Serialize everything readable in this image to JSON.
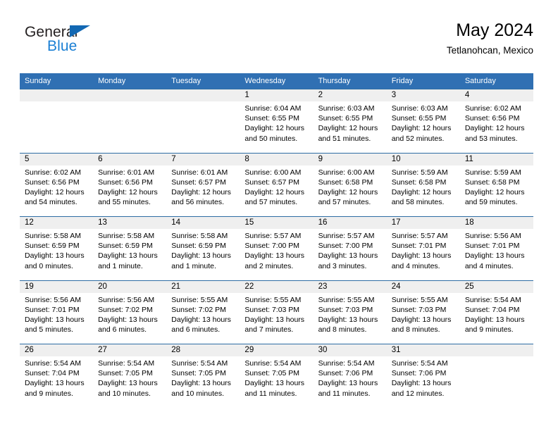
{
  "brand": {
    "name_top": "General",
    "name_bottom": "Blue",
    "accent_color": "#1268b3",
    "blue_text_color": "#1a7fd4"
  },
  "header": {
    "title": "May 2024",
    "subtitle": "Tetlanohcan, Mexico"
  },
  "theme": {
    "header_row_bg": "#3070b3",
    "cell_top_border": "#2e6da4",
    "daynum_bg": "#efefef"
  },
  "weekday_headers": [
    "Sunday",
    "Monday",
    "Tuesday",
    "Wednesday",
    "Thursday",
    "Friday",
    "Saturday"
  ],
  "weeks": [
    [
      {
        "day": "",
        "sunrise": "",
        "sunset": "",
        "daylight": "",
        "daylight2": ""
      },
      {
        "day": "",
        "sunrise": "",
        "sunset": "",
        "daylight": "",
        "daylight2": ""
      },
      {
        "day": "",
        "sunrise": "",
        "sunset": "",
        "daylight": "",
        "daylight2": ""
      },
      {
        "day": "1",
        "sunrise": "Sunrise: 6:04 AM",
        "sunset": "Sunset: 6:55 PM",
        "daylight": "Daylight: 12 hours",
        "daylight2": "and 50 minutes."
      },
      {
        "day": "2",
        "sunrise": "Sunrise: 6:03 AM",
        "sunset": "Sunset: 6:55 PM",
        "daylight": "Daylight: 12 hours",
        "daylight2": "and 51 minutes."
      },
      {
        "day": "3",
        "sunrise": "Sunrise: 6:03 AM",
        "sunset": "Sunset: 6:55 PM",
        "daylight": "Daylight: 12 hours",
        "daylight2": "and 52 minutes."
      },
      {
        "day": "4",
        "sunrise": "Sunrise: 6:02 AM",
        "sunset": "Sunset: 6:56 PM",
        "daylight": "Daylight: 12 hours",
        "daylight2": "and 53 minutes."
      }
    ],
    [
      {
        "day": "5",
        "sunrise": "Sunrise: 6:02 AM",
        "sunset": "Sunset: 6:56 PM",
        "daylight": "Daylight: 12 hours",
        "daylight2": "and 54 minutes."
      },
      {
        "day": "6",
        "sunrise": "Sunrise: 6:01 AM",
        "sunset": "Sunset: 6:56 PM",
        "daylight": "Daylight: 12 hours",
        "daylight2": "and 55 minutes."
      },
      {
        "day": "7",
        "sunrise": "Sunrise: 6:01 AM",
        "sunset": "Sunset: 6:57 PM",
        "daylight": "Daylight: 12 hours",
        "daylight2": "and 56 minutes."
      },
      {
        "day": "8",
        "sunrise": "Sunrise: 6:00 AM",
        "sunset": "Sunset: 6:57 PM",
        "daylight": "Daylight: 12 hours",
        "daylight2": "and 57 minutes."
      },
      {
        "day": "9",
        "sunrise": "Sunrise: 6:00 AM",
        "sunset": "Sunset: 6:58 PM",
        "daylight": "Daylight: 12 hours",
        "daylight2": "and 57 minutes."
      },
      {
        "day": "10",
        "sunrise": "Sunrise: 5:59 AM",
        "sunset": "Sunset: 6:58 PM",
        "daylight": "Daylight: 12 hours",
        "daylight2": "and 58 minutes."
      },
      {
        "day": "11",
        "sunrise": "Sunrise: 5:59 AM",
        "sunset": "Sunset: 6:58 PM",
        "daylight": "Daylight: 12 hours",
        "daylight2": "and 59 minutes."
      }
    ],
    [
      {
        "day": "12",
        "sunrise": "Sunrise: 5:58 AM",
        "sunset": "Sunset: 6:59 PM",
        "daylight": "Daylight: 13 hours",
        "daylight2": "and 0 minutes."
      },
      {
        "day": "13",
        "sunrise": "Sunrise: 5:58 AM",
        "sunset": "Sunset: 6:59 PM",
        "daylight": "Daylight: 13 hours",
        "daylight2": "and 1 minute."
      },
      {
        "day": "14",
        "sunrise": "Sunrise: 5:58 AM",
        "sunset": "Sunset: 6:59 PM",
        "daylight": "Daylight: 13 hours",
        "daylight2": "and 1 minute."
      },
      {
        "day": "15",
        "sunrise": "Sunrise: 5:57 AM",
        "sunset": "Sunset: 7:00 PM",
        "daylight": "Daylight: 13 hours",
        "daylight2": "and 2 minutes."
      },
      {
        "day": "16",
        "sunrise": "Sunrise: 5:57 AM",
        "sunset": "Sunset: 7:00 PM",
        "daylight": "Daylight: 13 hours",
        "daylight2": "and 3 minutes."
      },
      {
        "day": "17",
        "sunrise": "Sunrise: 5:57 AM",
        "sunset": "Sunset: 7:01 PM",
        "daylight": "Daylight: 13 hours",
        "daylight2": "and 4 minutes."
      },
      {
        "day": "18",
        "sunrise": "Sunrise: 5:56 AM",
        "sunset": "Sunset: 7:01 PM",
        "daylight": "Daylight: 13 hours",
        "daylight2": "and 4 minutes."
      }
    ],
    [
      {
        "day": "19",
        "sunrise": "Sunrise: 5:56 AM",
        "sunset": "Sunset: 7:01 PM",
        "daylight": "Daylight: 13 hours",
        "daylight2": "and 5 minutes."
      },
      {
        "day": "20",
        "sunrise": "Sunrise: 5:56 AM",
        "sunset": "Sunset: 7:02 PM",
        "daylight": "Daylight: 13 hours",
        "daylight2": "and 6 minutes."
      },
      {
        "day": "21",
        "sunrise": "Sunrise: 5:55 AM",
        "sunset": "Sunset: 7:02 PM",
        "daylight": "Daylight: 13 hours",
        "daylight2": "and 6 minutes."
      },
      {
        "day": "22",
        "sunrise": "Sunrise: 5:55 AM",
        "sunset": "Sunset: 7:03 PM",
        "daylight": "Daylight: 13 hours",
        "daylight2": "and 7 minutes."
      },
      {
        "day": "23",
        "sunrise": "Sunrise: 5:55 AM",
        "sunset": "Sunset: 7:03 PM",
        "daylight": "Daylight: 13 hours",
        "daylight2": "and 8 minutes."
      },
      {
        "day": "24",
        "sunrise": "Sunrise: 5:55 AM",
        "sunset": "Sunset: 7:03 PM",
        "daylight": "Daylight: 13 hours",
        "daylight2": "and 8 minutes."
      },
      {
        "day": "25",
        "sunrise": "Sunrise: 5:54 AM",
        "sunset": "Sunset: 7:04 PM",
        "daylight": "Daylight: 13 hours",
        "daylight2": "and 9 minutes."
      }
    ],
    [
      {
        "day": "26",
        "sunrise": "Sunrise: 5:54 AM",
        "sunset": "Sunset: 7:04 PM",
        "daylight": "Daylight: 13 hours",
        "daylight2": "and 9 minutes."
      },
      {
        "day": "27",
        "sunrise": "Sunrise: 5:54 AM",
        "sunset": "Sunset: 7:05 PM",
        "daylight": "Daylight: 13 hours",
        "daylight2": "and 10 minutes."
      },
      {
        "day": "28",
        "sunrise": "Sunrise: 5:54 AM",
        "sunset": "Sunset: 7:05 PM",
        "daylight": "Daylight: 13 hours",
        "daylight2": "and 10 minutes."
      },
      {
        "day": "29",
        "sunrise": "Sunrise: 5:54 AM",
        "sunset": "Sunset: 7:05 PM",
        "daylight": "Daylight: 13 hours",
        "daylight2": "and 11 minutes."
      },
      {
        "day": "30",
        "sunrise": "Sunrise: 5:54 AM",
        "sunset": "Sunset: 7:06 PM",
        "daylight": "Daylight: 13 hours",
        "daylight2": "and 11 minutes."
      },
      {
        "day": "31",
        "sunrise": "Sunrise: 5:54 AM",
        "sunset": "Sunset: 7:06 PM",
        "daylight": "Daylight: 13 hours",
        "daylight2": "and 12 minutes."
      },
      {
        "day": "",
        "sunrise": "",
        "sunset": "",
        "daylight": "",
        "daylight2": ""
      }
    ]
  ]
}
